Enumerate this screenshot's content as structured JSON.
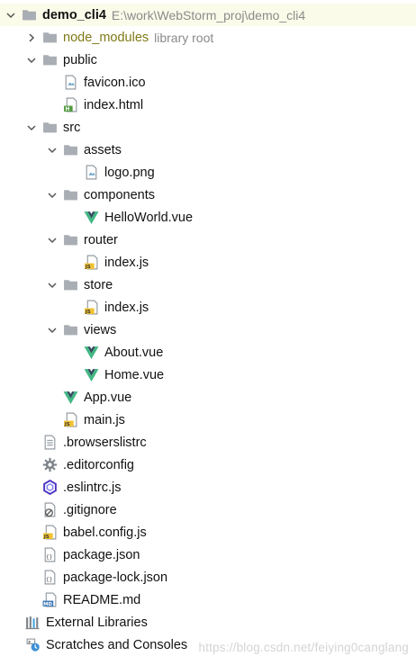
{
  "project": {
    "name": "demo_cli4",
    "path": "E:\\work\\WebStorm_proj\\demo_cli4"
  },
  "tree": [
    {
      "name": "node_modules",
      "hint": "library root",
      "depth": 1,
      "expanded": false,
      "icon": "folder-icon",
      "style": "olive"
    },
    {
      "name": "public",
      "depth": 1,
      "expanded": true,
      "icon": "folder-icon"
    },
    {
      "name": "favicon.ico",
      "depth": 2,
      "icon": "image-file-icon"
    },
    {
      "name": "index.html",
      "depth": 2,
      "icon": "html-file-icon"
    },
    {
      "name": "src",
      "depth": 1,
      "expanded": true,
      "icon": "folder-icon"
    },
    {
      "name": "assets",
      "depth": 2,
      "expanded": true,
      "icon": "folder-icon"
    },
    {
      "name": "logo.png",
      "depth": 3,
      "icon": "image-file-icon"
    },
    {
      "name": "components",
      "depth": 2,
      "expanded": true,
      "icon": "folder-icon"
    },
    {
      "name": "HelloWorld.vue",
      "depth": 3,
      "icon": "vue-file-icon"
    },
    {
      "name": "router",
      "depth": 2,
      "expanded": true,
      "icon": "folder-icon"
    },
    {
      "name": "index.js",
      "depth": 3,
      "icon": "js-file-icon"
    },
    {
      "name": "store",
      "depth": 2,
      "expanded": true,
      "icon": "folder-icon"
    },
    {
      "name": "index.js",
      "depth": 3,
      "icon": "js-file-icon"
    },
    {
      "name": "views",
      "depth": 2,
      "expanded": true,
      "icon": "folder-icon"
    },
    {
      "name": "About.vue",
      "depth": 3,
      "icon": "vue-file-icon"
    },
    {
      "name": "Home.vue",
      "depth": 3,
      "icon": "vue-file-icon"
    },
    {
      "name": "App.vue",
      "depth": 2,
      "icon": "vue-file-icon"
    },
    {
      "name": "main.js",
      "depth": 2,
      "icon": "js-file-icon"
    },
    {
      "name": ".browserslistrc",
      "depth": 1,
      "icon": "text-file-icon"
    },
    {
      "name": ".editorconfig",
      "depth": 1,
      "icon": "gear-icon"
    },
    {
      "name": ".eslintrc.js",
      "depth": 1,
      "icon": "eslint-icon"
    },
    {
      "name": ".gitignore",
      "depth": 1,
      "icon": "ignore-file-icon"
    },
    {
      "name": "babel.config.js",
      "depth": 1,
      "icon": "js-file-icon"
    },
    {
      "name": "package.json",
      "depth": 1,
      "icon": "json-file-icon"
    },
    {
      "name": "package-lock.json",
      "depth": 1,
      "icon": "json-file-icon"
    },
    {
      "name": "README.md",
      "depth": 1,
      "icon": "md-file-icon"
    }
  ],
  "footer": [
    {
      "name": "External Libraries",
      "icon": "libraries-icon"
    },
    {
      "name": "Scratches and Consoles",
      "icon": "scratches-icon"
    }
  ],
  "watermark": "https://blog.csdn.net/feiying0canglang",
  "colors": {
    "folder": "#a9aeb4",
    "vue_green": "#41b883",
    "vue_dark": "#35495e",
    "js_yellow": "#f1c232",
    "html_green": "#4f9a3c",
    "selected_row": "#fbfbea"
  }
}
